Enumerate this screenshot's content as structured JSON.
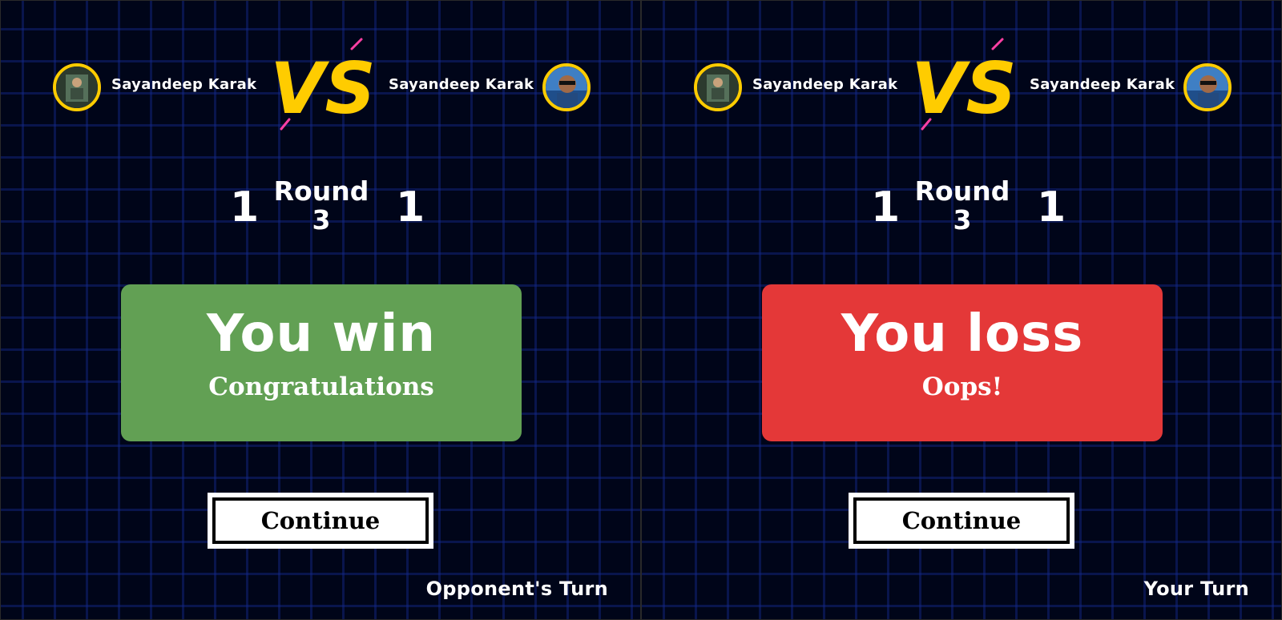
{
  "panels": [
    {
      "player_left": {
        "name": "Sayandeep Karak",
        "avatar": "avatar-photo-icon"
      },
      "player_right": {
        "name": "Sayandeep Karak",
        "avatar": "avatar-photo-icon"
      },
      "vs_label": "VS",
      "score_left": "1",
      "score_right": "1",
      "round_label": "Round",
      "round_number": "3",
      "result": {
        "title": "You win",
        "subtitle": "Congratulations",
        "color": "#62a054"
      },
      "continue_label": "Continue",
      "turn_status": "Opponent's Turn"
    },
    {
      "player_left": {
        "name": "Sayandeep Karak",
        "avatar": "avatar-photo-icon"
      },
      "player_right": {
        "name": "Sayandeep Karak",
        "avatar": "avatar-photo-icon"
      },
      "vs_label": "VS",
      "score_left": "1",
      "score_right": "1",
      "round_label": "Round",
      "round_number": "3",
      "result": {
        "title": "You loss",
        "subtitle": "Oops!",
        "color": "#e43838"
      },
      "continue_label": "Continue",
      "turn_status": "Your Turn"
    }
  ],
  "colors": {
    "background": "#000519",
    "grid": "#14288c",
    "accent_gold": "#ffcc00",
    "accent_pink": "#ff3fa4",
    "win": "#62a054",
    "loss": "#e43838"
  }
}
